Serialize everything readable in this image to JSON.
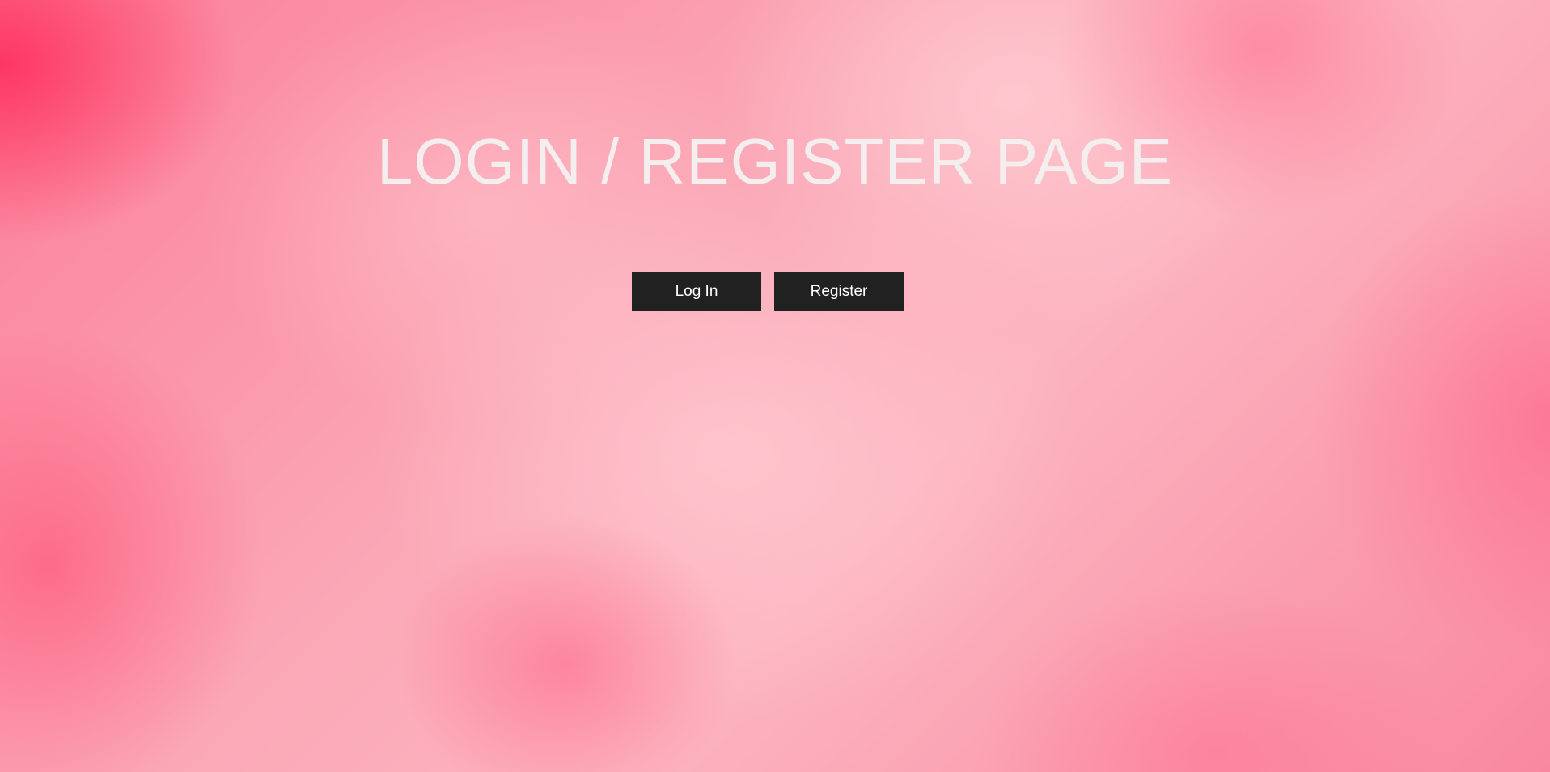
{
  "page": {
    "title": "LOGIN / REGISTER PAGE"
  },
  "actions": {
    "login_label": "Log In",
    "register_label": "Register"
  },
  "theme": {
    "background_accent": "#fb7f98",
    "button_color": "#212121",
    "title_color": "#f4eeef"
  }
}
